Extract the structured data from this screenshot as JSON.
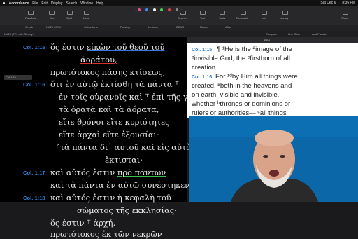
{
  "menubar": {
    "app": "Accordance",
    "items": [
      "File",
      "Edit",
      "Display",
      "Search",
      "Window",
      "Help"
    ],
    "right": [
      "Sat Dec 6",
      "8:36 PM"
    ]
  },
  "toolbar": {
    "buttons": [
      "Parallels",
      "Go",
      "Split",
      "New",
      "Search",
      "Text",
      "Tools",
      "Research",
      "Info",
      "Library",
      "Share"
    ]
  },
  "tabs": [
    "Greek",
    "NA28 / ESV",
    "Colossians",
    "Parsing",
    "Lexicon",
    "BDAG",
    "Notes",
    "Atlas"
  ],
  "address": {
    "left": "NA28 (TR) with Strong's",
    "reference": "Col 1:15",
    "right": [
      "Compare",
      "Live Click",
      "Add Parallel"
    ]
  },
  "greek_panel": {
    "verse_labels": [
      "Col. 1:15",
      "Col. 1:16",
      "Col. 1:17",
      "Col. 1:18"
    ],
    "lines": [
      "ὅς ἐστιν εἰκὼν τοῦ θεοῦ τοῦ",
      "ἀοράτου,",
      "πρωτότοκος πάσης κτίσεως,",
      "ὅτι ἐν αὐτῷ ἐκτίσθη τὰ πάντα ⸆",
      "ἐν τοῖς οὐρανοῖς καὶ ⸆ ἐπὶ τῆς γῆς,",
      "τὰ ὁρατὰ καὶ τὰ ἀόρατα,",
      "εἴτε θρόνοι εἴτε κυριότητες",
      "εἴτε ἀρχαὶ εἴτε ἐξουσίαι·",
      "⸂τὰ πάντα δι᾽ αὐτοῦ καὶ εἰς αὐτὸν",
      "ἔκτισται·",
      "καὶ αὐτός ἐστιν πρὸ πάντων",
      "καὶ τὰ πάντα ἐν αὐτῷ συνέστηκεν,",
      "καὶ αὐτός ἐστιν ἡ κεφαλὴ τοῦ",
      "σώματος τῆς ἐκκλησίας·",
      "ὅς ἐστιν ⸆ ἀρχή,",
      "πρωτότοκος ἐκ τῶν νεκρῶν"
    ]
  },
  "english_panel": {
    "header": "ESV",
    "verse_labels": [
      "Col. 1:15",
      "Col. 1:16"
    ],
    "lines": [
      "¶ ¹He is the ªimage of the",
      "ᵇinvisible God, the ᶜfirstborn of all",
      "creation.",
      "For ¹ᵈby Him all things were",
      "created, ªboth in the heavens and",
      "on earth, visible and invisible,",
      "whether ᵇthrones or dominions or",
      "rulers or authorities— ᶜall things"
    ]
  },
  "webcam": {
    "label": "presenter-video"
  }
}
